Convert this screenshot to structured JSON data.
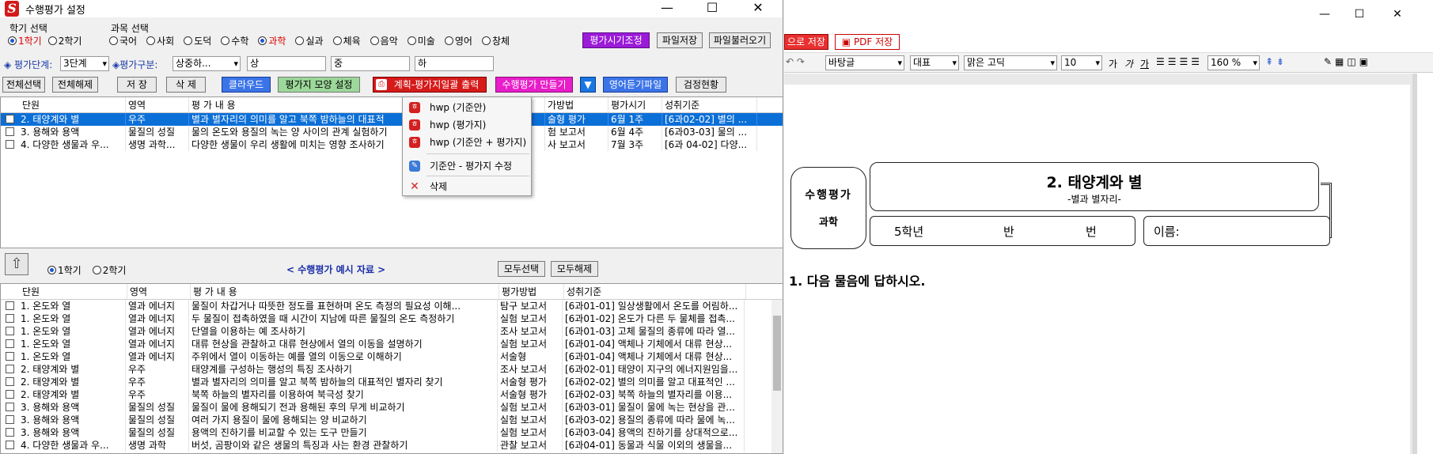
{
  "window": {
    "title": "수행평가 설정"
  },
  "semester": {
    "label": "학기 선택",
    "options": [
      "1학기",
      "2학기"
    ],
    "selected": 0
  },
  "subject": {
    "label": "과목 선택",
    "options": [
      "국어",
      "사회",
      "도덕",
      "수학",
      "과학",
      "실과",
      "체육",
      "음악",
      "미술",
      "영어",
      "창체"
    ],
    "selected": 4
  },
  "top_buttons": {
    "adjust": "평가시기조정",
    "save_file": "파일저장",
    "load_file": "파일불러오기"
  },
  "eval_row": {
    "level_label": "◈ 평가단계:",
    "level_value": "3단계",
    "kind_label": "◈평가구분:",
    "kind_value": "상중하...",
    "high": "상",
    "mid": "중",
    "low": "하"
  },
  "toolbar": {
    "select_all": "전체선택",
    "deselect_all": "전체해제",
    "save": "저 장",
    "delete": "삭 제",
    "cloud": "클라우드",
    "form_settings": "평가지 모양 설정",
    "print_plan": "계획-평가지일괄 출력",
    "make_eval": "수행평가 만들기",
    "english_listening": "영어듣기파일",
    "check_status": "검정현황"
  },
  "upper_grid": {
    "columns": [
      "단원",
      "영역",
      "평 가 내 용",
      "가방법",
      "평가시기",
      "성취기준"
    ],
    "rows": [
      {
        "unit": "2. 태양계와 별",
        "area": "우주",
        "content": "별과 별자리의 의미를 알고 북쪽 밤하늘의 대표적",
        "method": "술형 평가",
        "time": "6월 1주",
        "std": "[6과02-02] 별의 ...",
        "selected": true
      },
      {
        "unit": "3. 용해와 용액",
        "area": "물질의 성질",
        "content": "물의 온도와 용질의 녹는 양 사이의 관계 실험하기",
        "method": "험 보고서",
        "time": "6월 4주",
        "std": "[6과03-03] 물의 ...",
        "selected": false
      },
      {
        "unit": "4. 다양한 생물과 우...",
        "area": "생명 과학...",
        "content": "다양한 생물이 우리 생활에 미치는 영향 조사하기",
        "method": "사 보고서",
        "time": "7월 3주",
        "std": "[6과 04-02] 다양...",
        "selected": false
      }
    ]
  },
  "context_menu": {
    "items": [
      "hwp (기준안)",
      "hwp (평가지)",
      "hwp (기준안 + 평가지)",
      "기준안 - 평가지 수정",
      "삭제"
    ]
  },
  "lower_section": {
    "semester_options": [
      "1학기",
      "2학기"
    ],
    "selected": 0,
    "title": "< 수행평가 예시 자료 >",
    "select_all": "모두선택",
    "deselect_all": "모두해제"
  },
  "lower_grid": {
    "columns": [
      "단원",
      "영역",
      "평 가 내 용",
      "평가방법",
      "성취기준"
    ],
    "rows": [
      {
        "unit": "1. 온도와 열",
        "area": "열과 에너지",
        "content": "물질이 차갑거나 따뜻한 정도를 표현하며 온도 측정의 필요성 이해...",
        "method": "탐구 보고서",
        "std": "[6과01-01] 일상생활에서 온도를 어림하..."
      },
      {
        "unit": "1. 온도와 열",
        "area": "열과 에너지",
        "content": "두 물질이 접촉하였을 때 시간이 지남에 따른 물질의 온도 측정하기",
        "method": "실험 보고서",
        "std": "[6과01-02] 온도가 다른 두 물체를 접촉..."
      },
      {
        "unit": "1. 온도와 열",
        "area": "열과 에너지",
        "content": "단열을 이용하는 예 조사하기",
        "method": "조사 보고서",
        "std": "[6과01-03] 고체 물질의 종류에 따라 열..."
      },
      {
        "unit": "1. 온도와 열",
        "area": "열과 에너지",
        "content": "대류 현상을 관찰하고 대류 현상에서 열의 이동을 설명하기",
        "method": "실험 보고서",
        "std": "[6과01-04] 액체나 기체에서 대류 현상..."
      },
      {
        "unit": "1. 온도와 열",
        "area": "열과 에너지",
        "content": "주위에서 열이 이동하는 예를 열의 이동으로 이해하기",
        "method": "서술형",
        "std": "[6과01-04] 액체나 기체에서 대류 현상..."
      },
      {
        "unit": "2. 태양계와 별",
        "area": "우주",
        "content": "태양계를 구성하는 행성의 특징 조사하기",
        "method": "조사 보고서",
        "std": "[6과02-01] 태양이 지구의 에너지원임을..."
      },
      {
        "unit": "2. 태양계와 별",
        "area": "우주",
        "content": "별과 별자리의 의미를 알고 북쪽 밤하늘의 대표적인 별자리 찾기",
        "method": "서술형 평가",
        "std": "[6과02-02] 별의 의미를 알고 대표적인 ..."
      },
      {
        "unit": "2. 태양계와 별",
        "area": "우주",
        "content": "북쪽 하늘의 별자리를 이용하여 북극성 찾기",
        "method": "서술형 평가",
        "std": "[6과02-03] 북쪽 하늘의 별자리를 이용..."
      },
      {
        "unit": "3. 용해와 용액",
        "area": "물질의 성질",
        "content": "물질이 물에 용해되기 전과 용해된 후의 무게 비교하기",
        "method": "실험 보고서",
        "std": "[6과03-01] 물질이 물에 녹는 현상을 관..."
      },
      {
        "unit": "3. 용해와 용액",
        "area": "물질의 성질",
        "content": "여러 가지 용질이 물에 용해되는 양 비교하기",
        "method": "실험 보고서",
        "std": "[6과03-02] 용질의 종류에 따라 물에 녹..."
      },
      {
        "unit": "3. 용해와 용액",
        "area": "물질의 성질",
        "content": "용액의 진하기를 비교할 수 있는 도구 만들기",
        "method": "실험 보고서",
        "std": "[6과03-04] 용액의 진하기를 상대적으로..."
      },
      {
        "unit": "4. 다양한 생물과 우...",
        "area": "생명 과학",
        "content": "버섯, 곰팡이와 같은 생물의 특징과 사는 환경 관찰하기",
        "method": "관찰 보고서",
        "std": "[6과04-01] 동물과 식물 이외의 생물을..."
      }
    ]
  },
  "editor": {
    "save_as": "으로 저장",
    "pdf_save": "PDF 저장",
    "style": "바탕글",
    "para": "대표",
    "font": "맑은 고딕",
    "size": "10",
    "zoom": "160 %",
    "fmt": [
      "가",
      "가",
      "가"
    ],
    "doc": {
      "badge_line1": "수행평가",
      "badge_line2": "과학",
      "title": "2. 태양계와 별",
      "subtitle": "-별과 별자리-",
      "grade": "5학년",
      "ban": "반",
      "beon": "번",
      "name_label": "이름:",
      "question": "1. 다음 물음에 답하시오."
    }
  }
}
